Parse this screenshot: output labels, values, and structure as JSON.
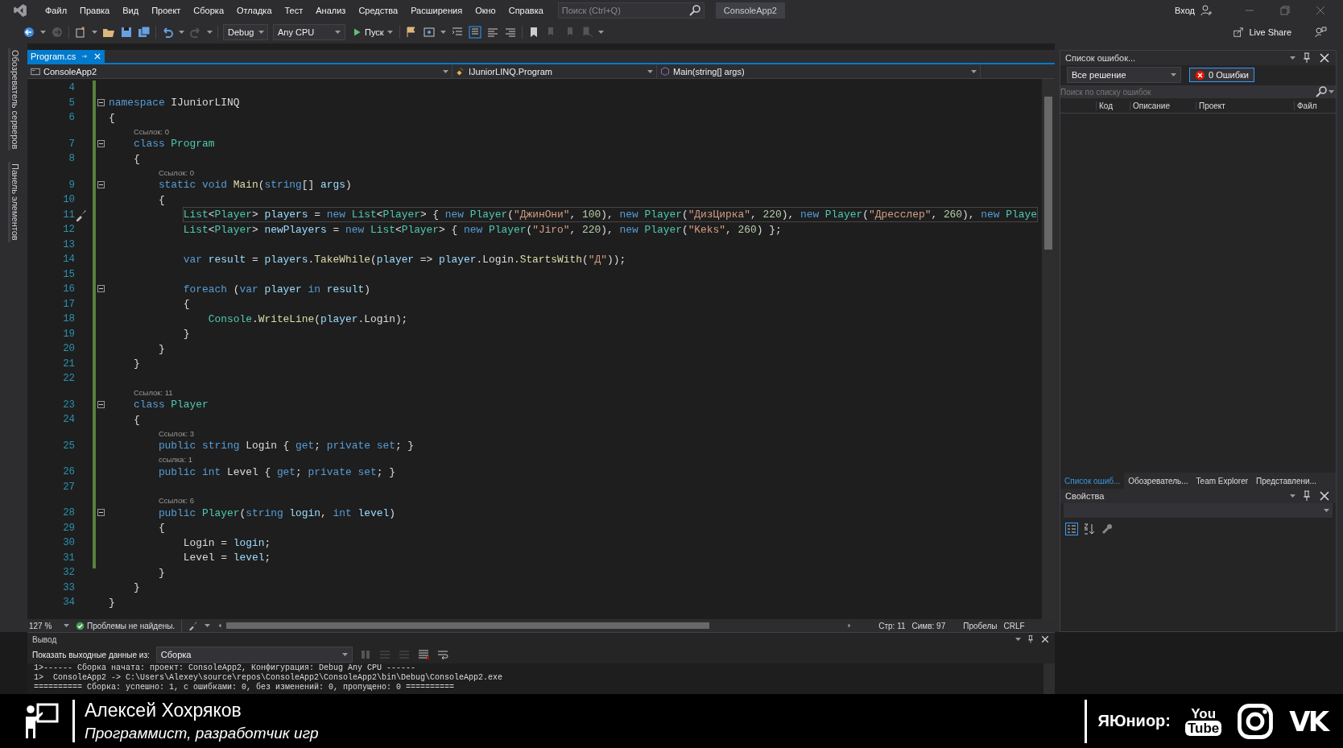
{
  "menu": {
    "items": [
      "Файл",
      "Правка",
      "Вид",
      "Проект",
      "Сборка",
      "Отладка",
      "Тест",
      "Анализ",
      "Средства",
      "Расширения",
      "Окно",
      "Справка"
    ],
    "search_placeholder": "Поиск (Ctrl+Q)",
    "solution_name": "ConsoleApp2",
    "sign_in": "Вход"
  },
  "toolbar": {
    "configuration": "Debug",
    "platform": "Any CPU",
    "start": "Пуск",
    "live_share": "Live Share"
  },
  "side_tabs": [
    "Обозреватель серверов",
    "Панель элементов"
  ],
  "editor": {
    "tabs": [
      {
        "label": "Program.cs",
        "selected": true
      }
    ],
    "nav": [
      "ConsoleApp2",
      "IJuniorLINQ.Program",
      "Main(string[] args)"
    ],
    "lines": [
      {
        "kind": "code",
        "number": "4",
        "fold": false,
        "current": false
      },
      {
        "kind": "code",
        "number": "5",
        "fold": true,
        "current": false,
        "tokens": [
          {
            "kind": "kw",
            "text": "namespace"
          },
          {
            "kind": "p",
            "text": " IJuniorLINQ"
          }
        ]
      },
      {
        "kind": "code",
        "number": "6",
        "fold": false,
        "current": false,
        "tokens": [
          {
            "kind": "p",
            "text": "{"
          }
        ],
        "children": [
          {
            "kind": "lens",
            "text": "Ссылок: 0"
          },
          {
            "kind": "code",
            "number": "7",
            "fold": true,
            "current": false,
            "tokens": [
              {
                "kind": "kw",
                "text": "class"
              },
              {
                "kind": "type",
                "text": " Program"
              }
            ]
          },
          {
            "kind": "code",
            "number": "8",
            "fold": false,
            "current": false,
            "tokens": [
              {
                "kind": "p",
                "text": "{"
              }
            ],
            "children": [
              {
                "kind": "lens",
                "text": "Ссылок: 0"
              },
              {
                "kind": "code",
                "number": "9",
                "fold": true,
                "current": false,
                "tokens": [
                  {
                    "kind": "kw",
                    "text": "static"
                  },
                  {
                    "kind": "kw",
                    "text": " void"
                  },
                  {
                    "kind": "method",
                    "text": " Main"
                  },
                  {
                    "kind": "p",
                    "text": "("
                  },
                  {
                    "kind": "kw",
                    "text": "string"
                  },
                  {
                    "kind": "p",
                    "text": "[] "
                  },
                  {
                    "kind": "var",
                    "text": "args"
                  },
                  {
                    "kind": "p",
                    "text": ")"
                  }
                ]
              },
              {
                "kind": "code",
                "number": "10",
                "fold": false,
                "current": false,
                "tokens": [
                  {
                    "kind": "p",
                    "text": "{"
                  }
                ],
                "children": [
                  {
                    "kind": "code",
                    "number": "11",
                    "fold": false,
                    "current": true,
                    "tokens": [
                      {
                        "kind": "type",
                        "text": "List"
                      },
                      {
                        "kind": "p",
                        "text": "<"
                      },
                      {
                        "kind": "type",
                        "text": "Player"
                      },
                      {
                        "kind": "p",
                        "text": "> "
                      },
                      {
                        "kind": "var",
                        "text": "players"
                      },
                      {
                        "kind": "p",
                        "text": " = "
                      },
                      {
                        "kind": "kw",
                        "text": "new"
                      },
                      {
                        "kind": "type",
                        "text": " List"
                      },
                      {
                        "kind": "p",
                        "text": "<"
                      },
                      {
                        "kind": "type",
                        "text": "Player"
                      },
                      {
                        "kind": "p",
                        "text": "> { "
                      },
                      {
                        "kind": "kw",
                        "text": "new"
                      },
                      {
                        "kind": "type",
                        "text": " Player"
                      },
                      {
                        "kind": "p",
                        "text": "("
                      },
                      {
                        "kind": "str",
                        "text": "\"ДжинОни\""
                      },
                      {
                        "kind": "p",
                        "text": ", "
                      },
                      {
                        "kind": "num",
                        "text": "100"
                      },
                      {
                        "kind": "p",
                        "text": "), "
                      },
                      {
                        "kind": "kw",
                        "text": "new"
                      },
                      {
                        "kind": "type",
                        "text": " Player"
                      },
                      {
                        "kind": "p",
                        "text": "("
                      },
                      {
                        "kind": "str",
                        "text": "\"ДизЦирка\""
                      },
                      {
                        "kind": "p",
                        "text": ", "
                      },
                      {
                        "kind": "num",
                        "text": "220"
                      },
                      {
                        "kind": "p",
                        "text": "), "
                      },
                      {
                        "kind": "kw",
                        "text": "new"
                      },
                      {
                        "kind": "type",
                        "text": " Player"
                      },
                      {
                        "kind": "p",
                        "text": "("
                      },
                      {
                        "kind": "str",
                        "text": "\"Дресслер\""
                      },
                      {
                        "kind": "p",
                        "text": ", "
                      },
                      {
                        "kind": "num",
                        "text": "260"
                      },
                      {
                        "kind": "p",
                        "text": "), "
                      },
                      {
                        "kind": "kw",
                        "text": "new"
                      },
                      {
                        "kind": "type",
                        "text": " Playe"
                      }
                    ]
                  },
                  {
                    "kind": "code",
                    "number": "12",
                    "fold": false,
                    "current": false,
                    "tokens": [
                      {
                        "kind": "type",
                        "text": "List"
                      },
                      {
                        "kind": "p",
                        "text": "<"
                      },
                      {
                        "kind": "type",
                        "text": "Player"
                      },
                      {
                        "kind": "p",
                        "text": "> "
                      },
                      {
                        "kind": "var",
                        "text": "newPlayers"
                      },
                      {
                        "kind": "p",
                        "text": " = "
                      },
                      {
                        "kind": "kw",
                        "text": "new"
                      },
                      {
                        "kind": "type",
                        "text": " List"
                      },
                      {
                        "kind": "p",
                        "text": "<"
                      },
                      {
                        "kind": "type",
                        "text": "Player"
                      },
                      {
                        "kind": "p",
                        "text": "> { "
                      },
                      {
                        "kind": "kw",
                        "text": "new"
                      },
                      {
                        "kind": "type",
                        "text": " Player"
                      },
                      {
                        "kind": "p",
                        "text": "("
                      },
                      {
                        "kind": "str",
                        "text": "\"Jiro\""
                      },
                      {
                        "kind": "p",
                        "text": ", "
                      },
                      {
                        "kind": "num",
                        "text": "220"
                      },
                      {
                        "kind": "p",
                        "text": "), "
                      },
                      {
                        "kind": "kw",
                        "text": "new"
                      },
                      {
                        "kind": "type",
                        "text": " Player"
                      },
                      {
                        "kind": "p",
                        "text": "("
                      },
                      {
                        "kind": "str",
                        "text": "\"Keks\""
                      },
                      {
                        "kind": "p",
                        "text": ", "
                      },
                      {
                        "kind": "num",
                        "text": "260"
                      },
                      {
                        "kind": "p",
                        "text": ") };"
                      }
                    ]
                  },
                  {
                    "kind": "code",
                    "number": "13",
                    "fold": false,
                    "current": false
                  },
                  {
                    "kind": "code",
                    "number": "14",
                    "fold": false,
                    "current": false,
                    "tokens": [
                      {
                        "kind": "kw",
                        "text": "var"
                      },
                      {
                        "kind": "var",
                        "text": " result"
                      },
                      {
                        "kind": "p",
                        "text": " = "
                      },
                      {
                        "kind": "var",
                        "text": "players"
                      },
                      {
                        "kind": "p",
                        "text": "."
                      },
                      {
                        "kind": "method",
                        "text": "TakeWhile"
                      },
                      {
                        "kind": "p",
                        "text": "("
                      },
                      {
                        "kind": "var",
                        "text": "player"
                      },
                      {
                        "kind": "p",
                        "text": " => "
                      },
                      {
                        "kind": "var",
                        "text": "player"
                      },
                      {
                        "kind": "p",
                        "text": ".Login."
                      },
                      {
                        "kind": "method",
                        "text": "StartsWith"
                      },
                      {
                        "kind": "p",
                        "text": "("
                      },
                      {
                        "kind": "str",
                        "text": "\"Д\""
                      },
                      {
                        "kind": "p",
                        "text": "));"
                      }
                    ]
                  },
                  {
                    "kind": "code",
                    "number": "15",
                    "fold": false,
                    "current": false
                  },
                  {
                    "kind": "code",
                    "number": "16",
                    "fold": true,
                    "current": false,
                    "tokens": [
                      {
                        "kind": "kw",
                        "text": "foreach"
                      },
                      {
                        "kind": "p",
                        "text": " ("
                      },
                      {
                        "kind": "kw",
                        "text": "var"
                      },
                      {
                        "kind": "var",
                        "text": " player"
                      },
                      {
                        "kind": "kw",
                        "text": " in"
                      },
                      {
                        "kind": "var",
                        "text": " result"
                      },
                      {
                        "kind": "p",
                        "text": ")"
                      }
                    ]
                  },
                  {
                    "kind": "code",
                    "number": "17",
                    "fold": false,
                    "current": false,
                    "tokens": [
                      {
                        "kind": "p",
                        "text": "{"
                      }
                    ],
                    "children": [
                      {
                        "kind": "code",
                        "number": "18",
                        "fold": false,
                        "current": false,
                        "tokens": [
                          {
                            "kind": "type",
                            "text": "Console"
                          },
                          {
                            "kind": "p",
                            "text": "."
                          },
                          {
                            "kind": "method",
                            "text": "WriteLine"
                          },
                          {
                            "kind": "p",
                            "text": "("
                          },
                          {
                            "kind": "var",
                            "text": "player"
                          },
                          {
                            "kind": "p",
                            "text": ".Login);"
                          }
                        ]
                      }
                    ]
                  },
                  {
                    "kind": "code",
                    "number": "19",
                    "fold": false,
                    "current": false,
                    "tokens": [
                      {
                        "kind": "p",
                        "text": "}"
                      }
                    ]
                  }
                ]
              },
              {
                "kind": "code",
                "number": "20",
                "fold": false,
                "current": false,
                "tokens": [
                  {
                    "kind": "p",
                    "text": "}"
                  }
                ]
              }
            ]
          },
          {
            "kind": "code",
            "number": "21",
            "fold": false,
            "current": false,
            "tokens": [
              {
                "kind": "p",
                "text": "}"
              }
            ]
          },
          {
            "kind": "code",
            "number": "22",
            "fold": false,
            "current": false
          },
          {
            "kind": "lens",
            "text": "Ссылок: 11"
          },
          {
            "kind": "code",
            "number": "23",
            "fold": true,
            "current": false,
            "tokens": [
              {
                "kind": "kw",
                "text": "class"
              },
              {
                "kind": "type",
                "text": " Player"
              }
            ]
          },
          {
            "kind": "code",
            "number": "24",
            "fold": false,
            "current": false,
            "tokens": [
              {
                "kind": "p",
                "text": "{"
              }
            ],
            "children": [
              {
                "kind": "lens",
                "text": "Ссылок: 3"
              },
              {
                "kind": "code",
                "number": "25",
                "fold": false,
                "current": false,
                "tokens": [
                  {
                    "kind": "kw",
                    "text": "public"
                  },
                  {
                    "kind": "kw",
                    "text": " string"
                  },
                  {
                    "kind": "p",
                    "text": " Login { "
                  },
                  {
                    "kind": "kw",
                    "text": "get"
                  },
                  {
                    "kind": "p",
                    "text": "; "
                  },
                  {
                    "kind": "kw",
                    "text": "private"
                  },
                  {
                    "kind": "kw",
                    "text": " set"
                  },
                  {
                    "kind": "p",
                    "text": "; }"
                  }
                ]
              },
              {
                "kind": "lens",
                "text": "ссылка: 1"
              },
              {
                "kind": "code",
                "number": "26",
                "fold": false,
                "current": false,
                "tokens": [
                  {
                    "kind": "kw",
                    "text": "public"
                  },
                  {
                    "kind": "kw",
                    "text": " int"
                  },
                  {
                    "kind": "p",
                    "text": " Level { "
                  },
                  {
                    "kind": "kw",
                    "text": "get"
                  },
                  {
                    "kind": "p",
                    "text": "; "
                  },
                  {
                    "kind": "kw",
                    "text": "private"
                  },
                  {
                    "kind": "kw",
                    "text": " set"
                  },
                  {
                    "kind": "p",
                    "text": "; }"
                  }
                ]
              },
              {
                "kind": "code",
                "number": "27",
                "fold": false,
                "current": false
              },
              {
                "kind": "lens",
                "text": "Ссылок: 6"
              },
              {
                "kind": "code",
                "number": "28",
                "fold": true,
                "current": false,
                "tokens": [
                  {
                    "kind": "kw",
                    "text": "public"
                  },
                  {
                    "kind": "type",
                    "text": " Player"
                  },
                  {
                    "kind": "p",
                    "text": "("
                  },
                  {
                    "kind": "kw",
                    "text": "string"
                  },
                  {
                    "kind": "var",
                    "text": " login"
                  },
                  {
                    "kind": "p",
                    "text": ", "
                  },
                  {
                    "kind": "kw",
                    "text": "int"
                  },
                  {
                    "kind": "var",
                    "text": " level"
                  },
                  {
                    "kind": "p",
                    "text": ")"
                  }
                ]
              },
              {
                "kind": "code",
                "number": "29",
                "fold": false,
                "current": false,
                "tokens": [
                  {
                    "kind": "p",
                    "text": "{"
                  }
                ],
                "children": [
                  {
                    "kind": "code",
                    "number": "30",
                    "fold": false,
                    "current": false,
                    "tokens": [
                      {
                        "kind": "p",
                        "text": "Login = "
                      },
                      {
                        "kind": "var",
                        "text": "login"
                      },
                      {
                        "kind": "p",
                        "text": ";"
                      }
                    ]
                  },
                  {
                    "kind": "code",
                    "number": "31",
                    "fold": false,
                    "current": false,
                    "tokens": [
                      {
                        "kind": "p",
                        "text": "Level = "
                      },
                      {
                        "kind": "var",
                        "text": "level"
                      },
                      {
                        "kind": "p",
                        "text": ";"
                      }
                    ]
                  }
                ]
              },
              {
                "kind": "code",
                "number": "32",
                "fold": false,
                "current": false,
                "tokens": [
                  {
                    "kind": "p",
                    "text": "}"
                  }
                ]
              }
            ]
          },
          {
            "kind": "code",
            "number": "33",
            "fold": false,
            "current": false,
            "tokens": [
              {
                "kind": "p",
                "text": "}"
              }
            ]
          }
        ]
      },
      {
        "kind": "code",
        "number": "34",
        "fold": false,
        "current": false,
        "tokens": [
          {
            "kind": "p",
            "text": "}"
          }
        ]
      }
    ],
    "status": {
      "zoom": "127 %",
      "issues": "Проблемы не найдены.",
      "line": "Стр: 11",
      "column": "Симв: 97",
      "whitespace": "Пробелы",
      "line_endings": "CRLF"
    }
  },
  "error_list": {
    "title": "Список ошибок...",
    "scope": "Все решение",
    "errors_filter": "0 Ошибки",
    "search_placeholder": "Поиск по списку ошибок",
    "columns": [
      "Код",
      "Описание",
      "Проект",
      "Файл"
    ]
  },
  "panel_tabs": [
    {
      "label": "Список ошиб...",
      "selected": true
    },
    {
      "label": "Обозреватель...",
      "selected": false
    },
    {
      "label": "Team Explorer",
      "selected": false
    },
    {
      "label": "Представлени...",
      "selected": false
    }
  ],
  "properties": {
    "title": "Свойства"
  },
  "output": {
    "title": "Вывод",
    "source_label": "Показать выходные данные из:",
    "source": "Сборка",
    "lines": [
      "1>------ Сборка начата: проект: ConsoleApp2, Конфигурация: Debug Any CPU ------",
      "1>  ConsoleApp2 -> C:\\Users\\Alexey\\source\\repos\\ConsoleApp2\\ConsoleApp2\\bin\\Debug\\ConsoleApp2.exe",
      "========== Сборка: успешно: 1, с ошибками: 0, без изменений: 0, пропущено: 0 =========="
    ]
  },
  "banner": {
    "name": "Алексей Хохряков",
    "role": "Программист, разработчик игр",
    "brand": "ЯЮниор:",
    "youtube": [
      "You",
      "Tube"
    ],
    "vk": "VK"
  }
}
